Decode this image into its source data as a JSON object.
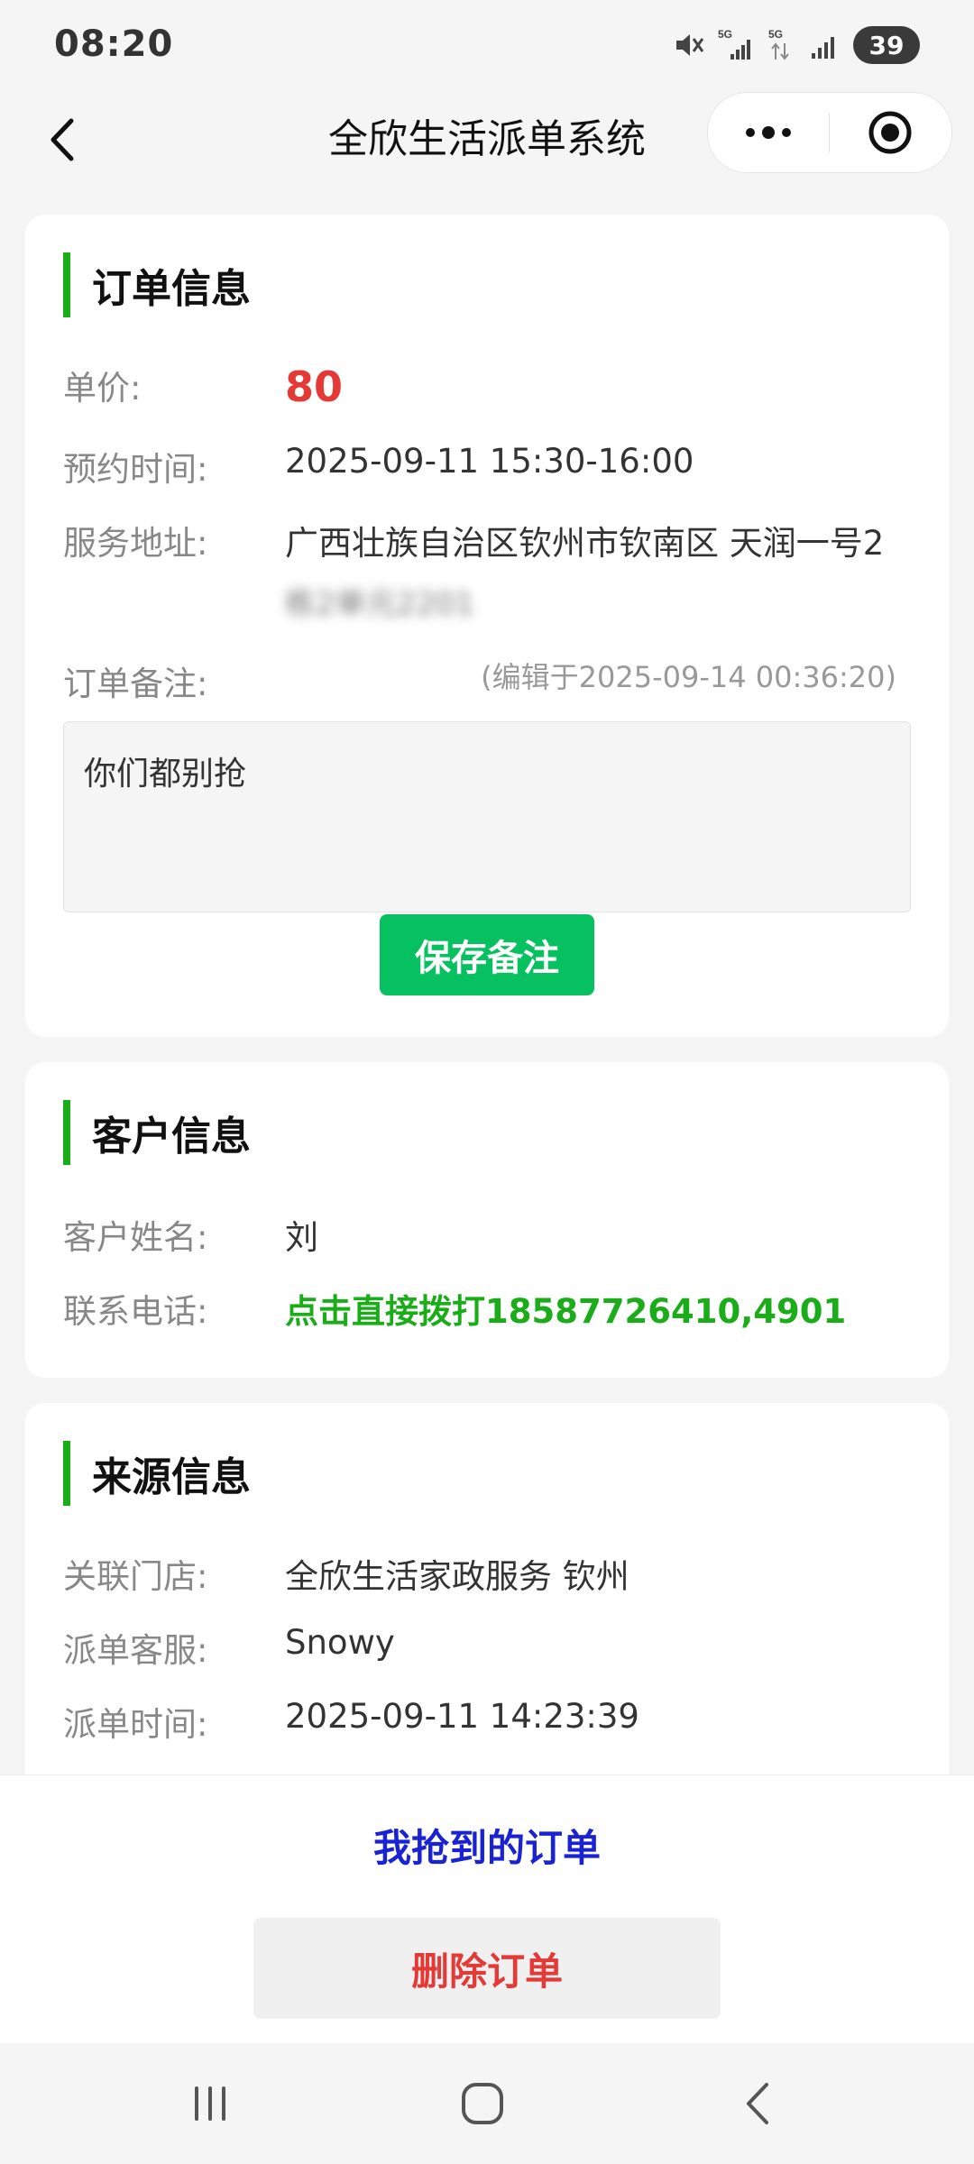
{
  "status_bar": {
    "time": "08:20",
    "battery": "39",
    "icons": [
      "mute-icon",
      "5g-signal-icon",
      "5g-data-icon",
      "signal-icon",
      "battery-icon"
    ]
  },
  "nav": {
    "title": "全欣生活派单系统",
    "icons": [
      "back-arrow-icon",
      "more-dots-icon",
      "close-target-icon"
    ]
  },
  "order_info": {
    "title": "订单信息",
    "price_label": "单价:",
    "price_value": "80",
    "appointment_label": "预约时间:",
    "appointment_value": "2025-09-11 15:30-16:00",
    "address_label": "服务地址:",
    "address_value": "广西壮族自治区钦州市钦南区 天润一号2",
    "address_detail_blurred": "栋2单元2201",
    "remark_label": "订单备注:",
    "remark_edited": "(编辑于2025-09-14 00:36:20)",
    "remark_text": "你们都别抢",
    "save_button": "保存备注"
  },
  "customer_info": {
    "title": "客户信息",
    "name_label": "客户姓名:",
    "name_value": "刘",
    "phone_label": "联系电话:",
    "phone_value": "点击直接拨打18587726410,4901"
  },
  "source_info": {
    "title": "来源信息",
    "store_label": "关联门店:",
    "store_value": "全欣生活家政服务 钦州",
    "dispatcher_label": "派单客服:",
    "dispatcher_value": "Snowy",
    "dispatch_time_label": "派单时间:",
    "dispatch_time_value": "2025-09-11 14:23:39"
  },
  "actions": {
    "my_orders": "我抢到的订单",
    "delete_order": "删除订单"
  },
  "system_nav": {
    "icons": [
      "recent-apps-icon",
      "home-icon",
      "back-icon"
    ]
  },
  "colors": {
    "accent_green": "#1aad19",
    "button_green": "#07c160",
    "price_red": "#e53935",
    "link_blue": "#1a22d6"
  }
}
